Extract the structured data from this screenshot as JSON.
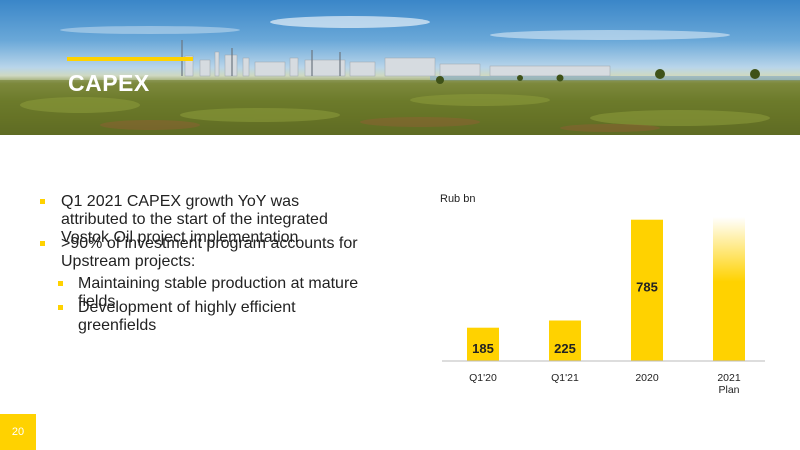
{
  "slide": {
    "title": "CAPEX",
    "page_number": "20",
    "colors": {
      "accent": "#ffd200",
      "text": "#222222"
    }
  },
  "bullets": [
    {
      "text": "Q1 2021 CAPEX  growth YoY was attributed to the start of the integrated Vostok Oil project implementation",
      "level": 1
    },
    {
      "text": ">90% of investment program accounts for Upstream projects:",
      "level": 1
    },
    {
      "text": "Maintaining stable production at mature fields",
      "level": 2
    },
    {
      "text": "Development of highly efficient greenfields",
      "level": 2
    }
  ],
  "chart_data": {
    "type": "bar",
    "unit_label": "Rub bn",
    "categories": [
      "Q1'20",
      "Q1'21",
      "2020",
      "2021\nPlan"
    ],
    "values": [
      185,
      225,
      785,
      null
    ],
    "value_labels": [
      "185",
      "225",
      "785",
      ""
    ],
    "ylim": [
      0,
      800
    ],
    "bar_color": "#ffd200",
    "last_bar_style": "gradient fading to white, unlabeled",
    "grid": false
  }
}
